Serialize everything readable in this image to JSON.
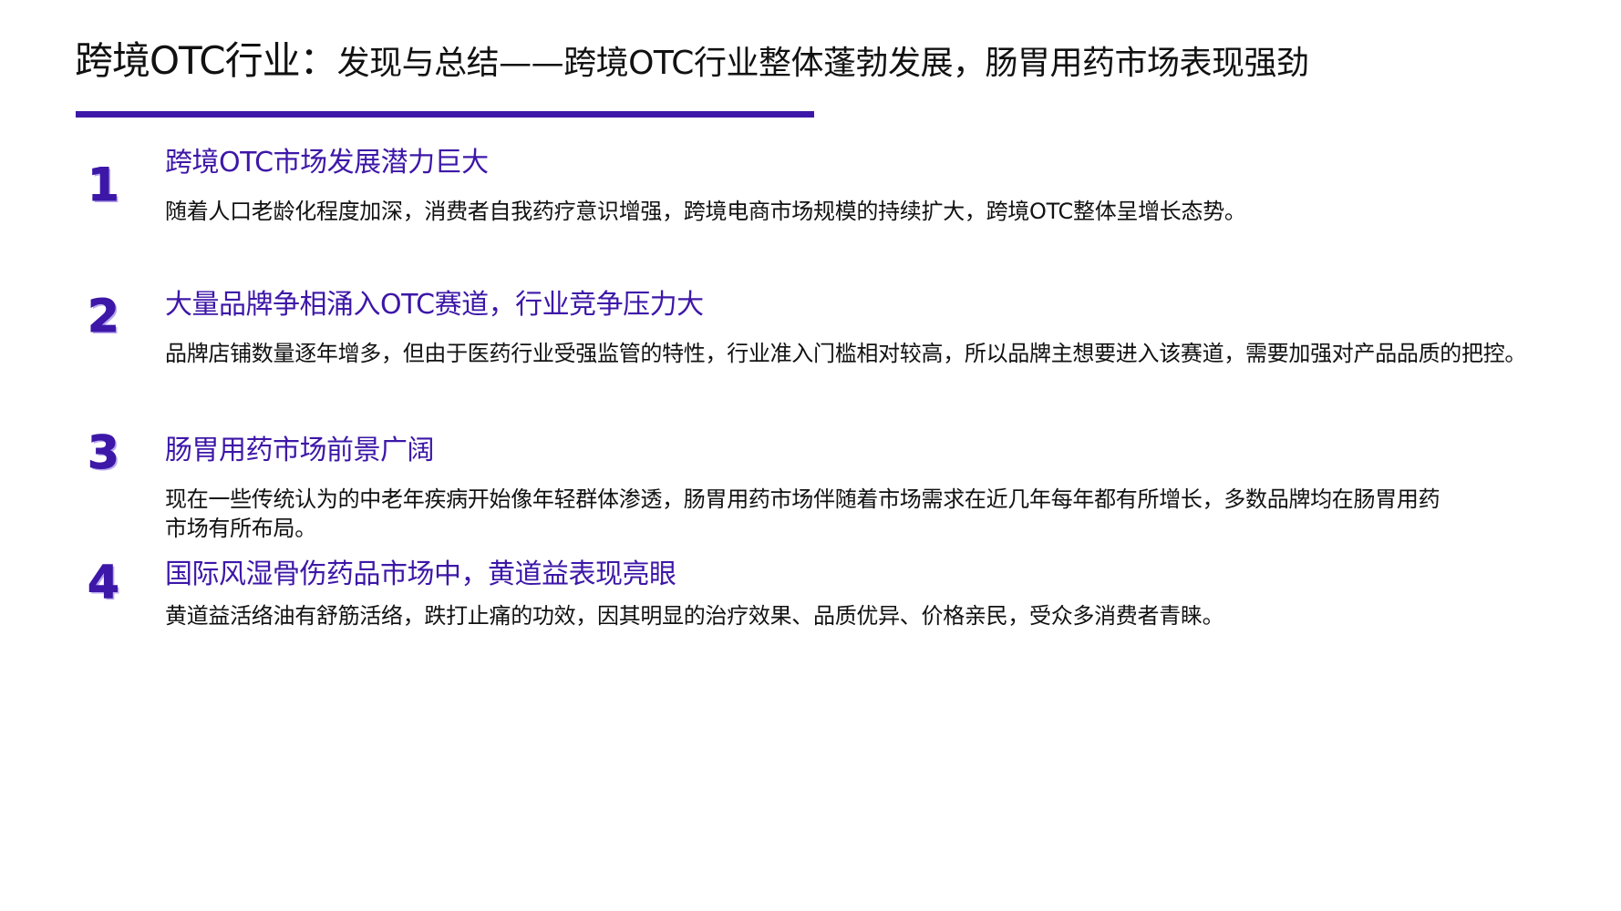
{
  "header": {
    "title_main": "跨境OTC行业：",
    "title_sub": "发现与总结——跨境OTC行业整体蓬勃发展，肠胃用药市场表现强劲"
  },
  "items": [
    {
      "number": "1",
      "heading": "跨境OTC市场发展潜力巨大",
      "text": "随着人口老龄化程度加深，消费者自我药疗意识增强，跨境电商市场规模的持续扩大，跨境OTC整体呈增长态势。"
    },
    {
      "number": "2",
      "heading": "大量品牌争相涌入OTC赛道，行业竞争压力大",
      "text": "品牌店铺数量逐年增多，但由于医药行业受强监管的特性，行业准入门槛相对较高，所以品牌主想要进入该赛道，需要加强对产品品质的把控。"
    },
    {
      "number": "3",
      "heading": "肠胃用药市场前景广阔",
      "text": "现在一些传统认为的中老年疾病开始像年轻群体渗透，肠胃用药市场伴随着市场需求在近几年每年都有所增长，多数品牌均在肠胃用药市场有所布局。"
    },
    {
      "number": "4",
      "heading": "国际风湿骨伤药品市场中，黄道益表现亮眼",
      "text": "黄道益活络油有舒筋活络，跌打止痛的功效，因其明显的治疗效果、品质优异、价格亲民，受众多消费者青睐。"
    }
  ],
  "colors": {
    "accent": "#3d17a8",
    "text": "#111111"
  }
}
